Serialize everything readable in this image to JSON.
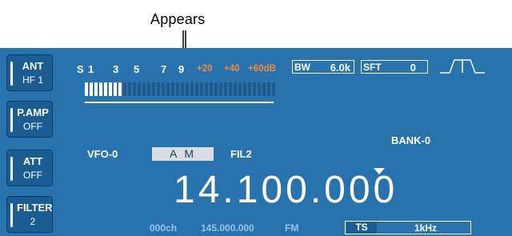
{
  "callout": "Appears",
  "side_keys": [
    {
      "title": "ANT",
      "value": "HF 1"
    },
    {
      "title": "P.AMP",
      "value": "OFF"
    },
    {
      "title": "ATT",
      "value": "OFF"
    },
    {
      "title": "FILTER",
      "value": "2"
    }
  ],
  "smeter": {
    "s_label": "S",
    "scale": [
      "1",
      "3",
      "5",
      "7",
      "9"
    ],
    "over": [
      "+20",
      "+40",
      "+60dB"
    ],
    "level_fraction": 0.19
  },
  "bw": {
    "label": "BW",
    "value": "6.0k"
  },
  "sft": {
    "label": "SFT",
    "value": "0"
  },
  "bank": "BANK-0",
  "vfo": "VFO-0",
  "mode": "A M",
  "filter": "FIL2",
  "frequency": "14.100.000",
  "memory": {
    "channel": "000ch",
    "freq": "145.000.000",
    "mode": "FM"
  },
  "ts": {
    "label": "TS",
    "value": "1kHz"
  },
  "colors": {
    "screen": "#2873ad",
    "over_scale": "#f28a3c",
    "mode_box": "#d9dce0"
  }
}
